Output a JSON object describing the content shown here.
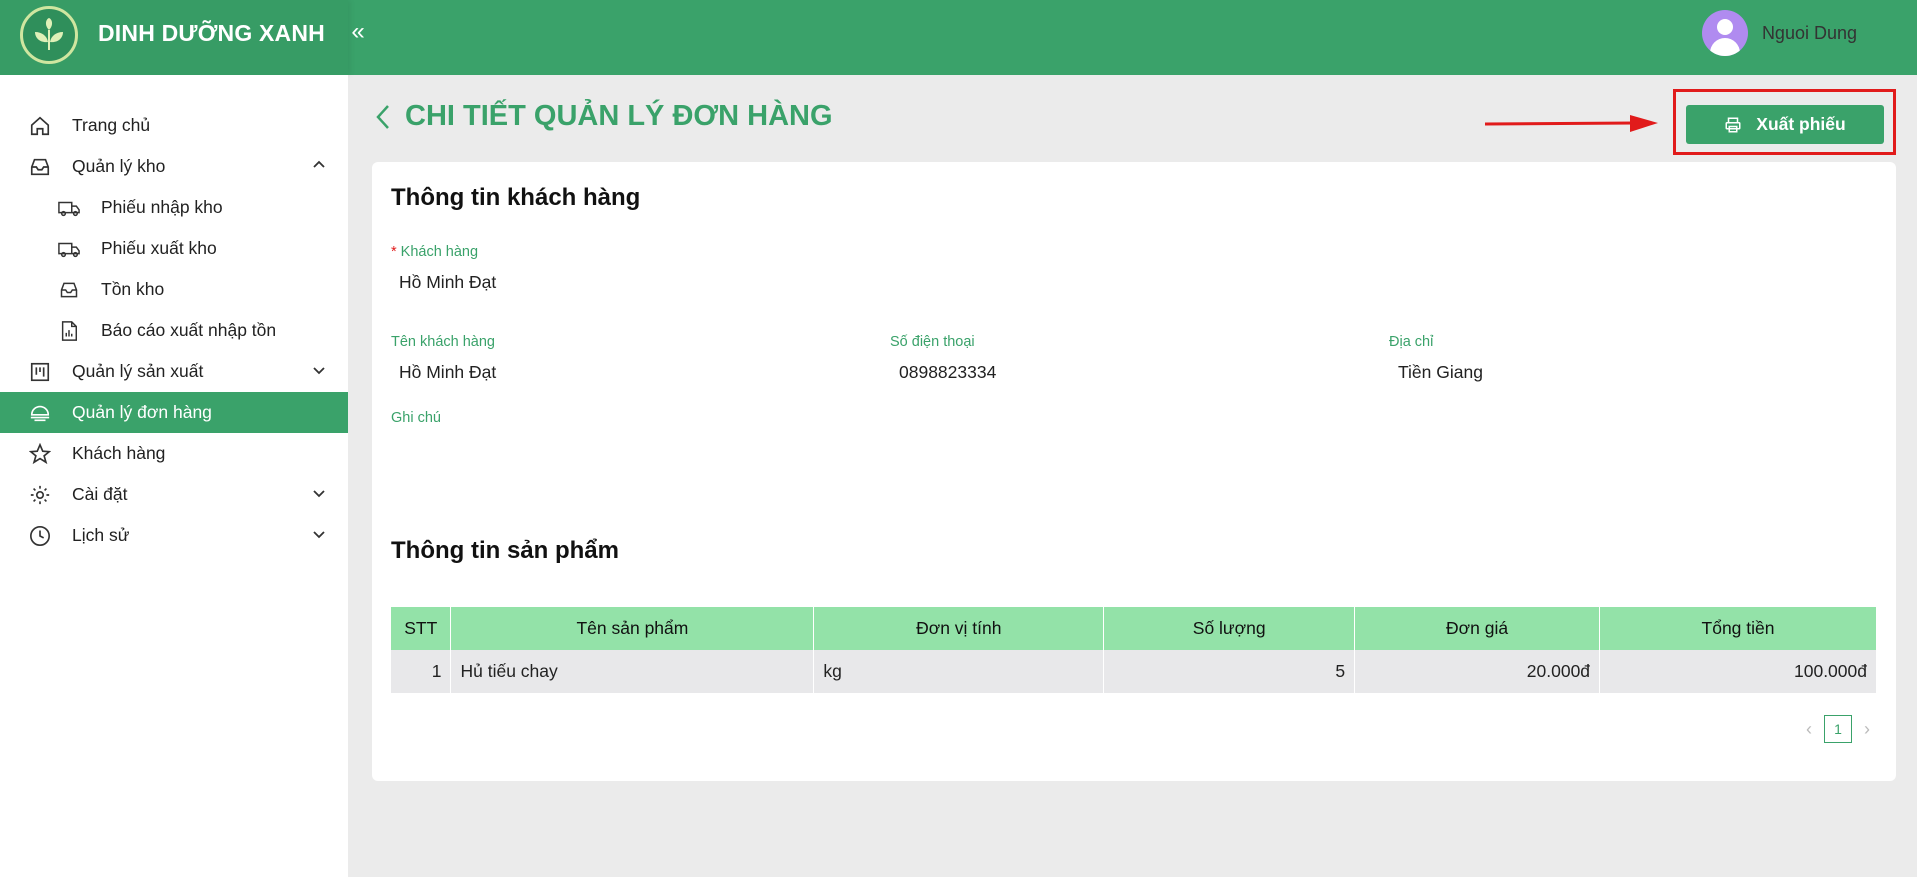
{
  "brand": {
    "name": "DINH DƯỠNG XANH"
  },
  "header": {
    "collapse_icon": "«",
    "user_name": "Nguoi Dung"
  },
  "sidebar": {
    "items": [
      {
        "label": "Trang chủ"
      },
      {
        "label": "Quản lý kho"
      },
      {
        "label": "Phiếu nhập kho"
      },
      {
        "label": "Phiếu xuất kho"
      },
      {
        "label": "Tồn kho"
      },
      {
        "label": "Báo cáo xuất nhập tồn"
      },
      {
        "label": "Quản lý sản xuất"
      },
      {
        "label": "Quản lý đơn hàng"
      },
      {
        "label": "Khách hàng"
      },
      {
        "label": "Cài đặt"
      },
      {
        "label": "Lịch sử"
      }
    ]
  },
  "page": {
    "title": "CHI TIẾT QUẢN LÝ ĐƠN HÀNG",
    "export_label": "Xuất phiếu"
  },
  "customer": {
    "section_title": "Thông tin khách hàng",
    "customer_label": "Khách hàng",
    "customer_value": "Hồ Minh Đạt",
    "name_label": "Tên khách hàng",
    "name_value": "Hồ Minh Đạt",
    "phone_label": "Số điện thoại",
    "phone_value": "0898823334",
    "address_label": "Địa chỉ",
    "address_value": "Tiền Giang",
    "note_label": "Ghi chú"
  },
  "products": {
    "section_title": "Thông tin sản phẩm",
    "columns": [
      "STT",
      "Tên sản phẩm",
      "Đơn vị tính",
      "Số lượng",
      "Đơn giá",
      "Tổng tiền"
    ],
    "rows": [
      {
        "stt": "1",
        "name": "Hủ tiếu chay",
        "unit": "kg",
        "qty": "5",
        "price": "20.000đ",
        "total": "100.000đ"
      }
    ],
    "current_page": "1"
  },
  "colors": {
    "primary": "#3aa26a",
    "table_header": "#93e2a8",
    "highlight": "#e11b1b"
  }
}
